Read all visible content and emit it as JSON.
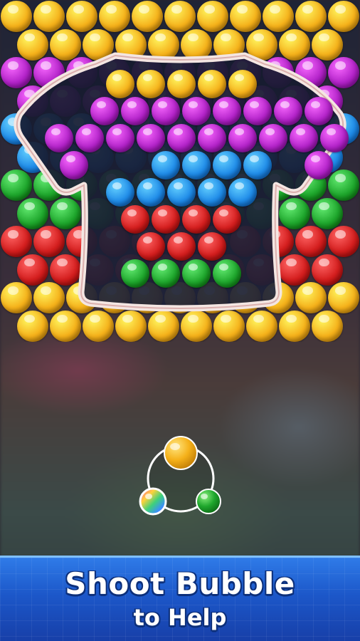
{
  "banner": {
    "line1": "Shoot Bubble",
    "line2": "to Help"
  },
  "colors": {
    "Y": "#f5b11a",
    "P": "#b323c9",
    "B": "#1f8be8",
    "G": "#1ea62c",
    "R": "#d41e1e",
    "banner": "#1c57c9",
    "shirt_outline": "#f4e6e2"
  },
  "grid": {
    "rows": [
      "YYYYYYYYYYY",
      "YYYYYYYYYY",
      "PPPPPPPPPPP",
      "PPPPPPPPPP",
      "BBBBBBBBBBB",
      "BBBBBBBBBB",
      "GGGGGGGGGGG",
      "GGGGGGGGGG",
      "RRRRRRRRRRR",
      "RRRRRRRRRR",
      "YYYYYYYYYYY",
      "YYYYYYYYYY"
    ]
  },
  "shirt": {
    "rows": [
      "...YYYYY...",
      "..PPPPPPPP",
      ".PPPPPPPPPP",
      ".P..BBBB.P",
      "...BBBBB...",
      "...RRRR...",
      "....RRR....",
      "...GGGG..."
    ]
  },
  "launcher": {
    "current": "yellow",
    "next": "green",
    "special": "rainbow-bubble"
  }
}
